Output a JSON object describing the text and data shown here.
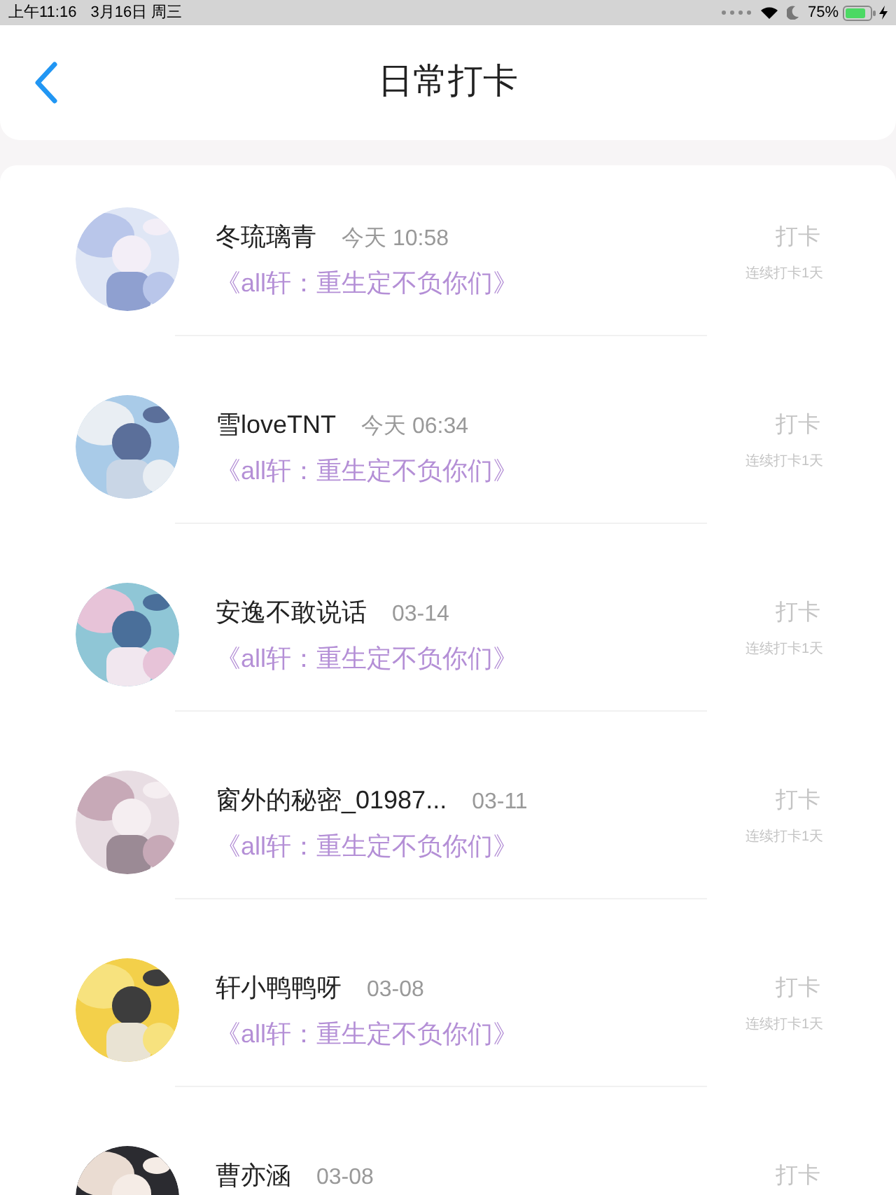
{
  "status_bar": {
    "time": "上午11:16",
    "date": "3月16日 周三",
    "battery": "75%"
  },
  "header": {
    "title": "日常打卡"
  },
  "entries": [
    {
      "name": "冬琉璃青",
      "time": "今天 10:58",
      "subtitle": "《all轩：重生定不负你们》",
      "action": "打卡",
      "streak": "连续打卡1天"
    },
    {
      "name": "雪loveTNT",
      "time": "今天 06:34",
      "subtitle": "《all轩：重生定不负你们》",
      "action": "打卡",
      "streak": "连续打卡1天"
    },
    {
      "name": "安逸不敢说话",
      "time": "03-14",
      "subtitle": "《all轩：重生定不负你们》",
      "action": "打卡",
      "streak": "连续打卡1天"
    },
    {
      "name": "窗外的秘密_01987...",
      "time": "03-11",
      "subtitle": "《all轩：重生定不负你们》",
      "action": "打卡",
      "streak": "连续打卡1天"
    },
    {
      "name": "轩小鸭鸭呀",
      "time": "03-08",
      "subtitle": "《all轩：重生定不负你们》",
      "action": "打卡",
      "streak": "连续打卡1天"
    },
    {
      "name": "曹亦涵",
      "time": "03-08",
      "action": "打卡"
    }
  ]
}
